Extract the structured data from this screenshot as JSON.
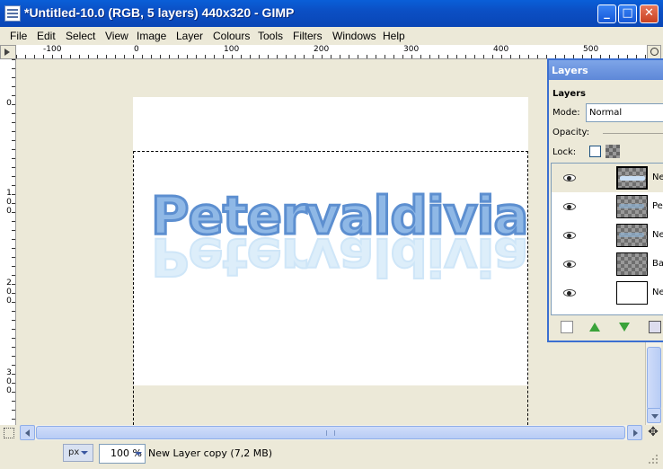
{
  "window": {
    "title": "*Untitled-10.0 (RGB, 5 layers) 440x320 - GIMP",
    "minimize_label": "_",
    "maximize_label": "□",
    "close_label": "✕"
  },
  "menu": [
    {
      "label": "File"
    },
    {
      "label": "Edit"
    },
    {
      "label": "Select"
    },
    {
      "label": "View"
    },
    {
      "label": "Image"
    },
    {
      "label": "Layer"
    },
    {
      "label": "Colours"
    },
    {
      "label": "Tools"
    },
    {
      "label": "Filters"
    },
    {
      "label": "Windows"
    },
    {
      "label": "Help"
    }
  ],
  "ruler": {
    "top_labels": [
      "-100",
      "0",
      "100",
      "200",
      "300",
      "400",
      "500"
    ],
    "left_labels": [
      "0",
      "100",
      "200",
      "300"
    ]
  },
  "canvas": {
    "text": "Petervaldivia",
    "text_color": "#8fb8e6",
    "outline_color": "#5d8fd0"
  },
  "statusbar": {
    "unit": "px",
    "zoom": "100 %",
    "message": "New Layer copy (7,2 MB)"
  },
  "layers_dialog": {
    "title": "Layers",
    "heading": "Layers",
    "mode_label": "Mode:",
    "mode_value": "Normal",
    "opacity_label": "Opacity:",
    "lock_label": "Lock:",
    "layers": [
      {
        "name": "New",
        "selected": true
      },
      {
        "name": "Pete",
        "selected": false
      },
      {
        "name": "New",
        "selected": false
      },
      {
        "name": "Back",
        "selected": false
      },
      {
        "name": "New",
        "selected": false
      }
    ]
  }
}
